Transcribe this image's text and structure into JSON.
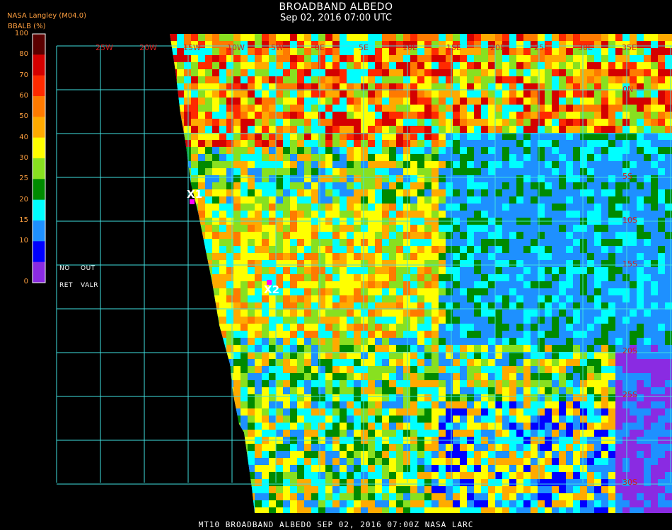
{
  "header": {
    "title": "BROADBAND ALBEDO",
    "datetime": "Sep 02, 2016 07:00 UTC",
    "producer": "NASA Langley (M04.0)"
  },
  "colorbar": {
    "label": "BBALB (%)",
    "ticks": [
      "100",
      "80",
      "70",
      "60",
      "50",
      "40",
      "30",
      "25",
      "20",
      "15",
      "10",
      "0"
    ],
    "colors": [
      "#5a0000",
      "#d40000",
      "#ff2a00",
      "#ff7a00",
      "#ffaa00",
      "#ffff00",
      "#88e020",
      "#008a00",
      "#00ffff",
      "#1e90ff",
      "#0000ff",
      "#8a2be2"
    ],
    "no_ret_label_1": "NO",
    "no_ret_label_2": "RET",
    "out_valr_label_1": "OUT",
    "out_valr_label_2": "VALR"
  },
  "map": {
    "lon_labels": [
      "25W",
      "20W",
      "15W",
      "10W",
      "5W",
      "0E",
      "5E",
      "10E",
      "15E",
      "20E",
      "25E",
      "30E",
      "35E"
    ],
    "lat_labels": [
      "0N",
      "5S",
      "10S",
      "15S",
      "20S",
      "25S",
      "30S"
    ],
    "markers": [
      {
        "label": "X1",
        "color": "#ff00ff"
      },
      {
        "label": "X2",
        "color": "#ff00ff"
      }
    ],
    "grid_color": "#40e0e0"
  },
  "footer": {
    "text": "MT10  BROADBAND ALBEDO   SEP 02, 2016 07:00Z   NASA LARC"
  }
}
